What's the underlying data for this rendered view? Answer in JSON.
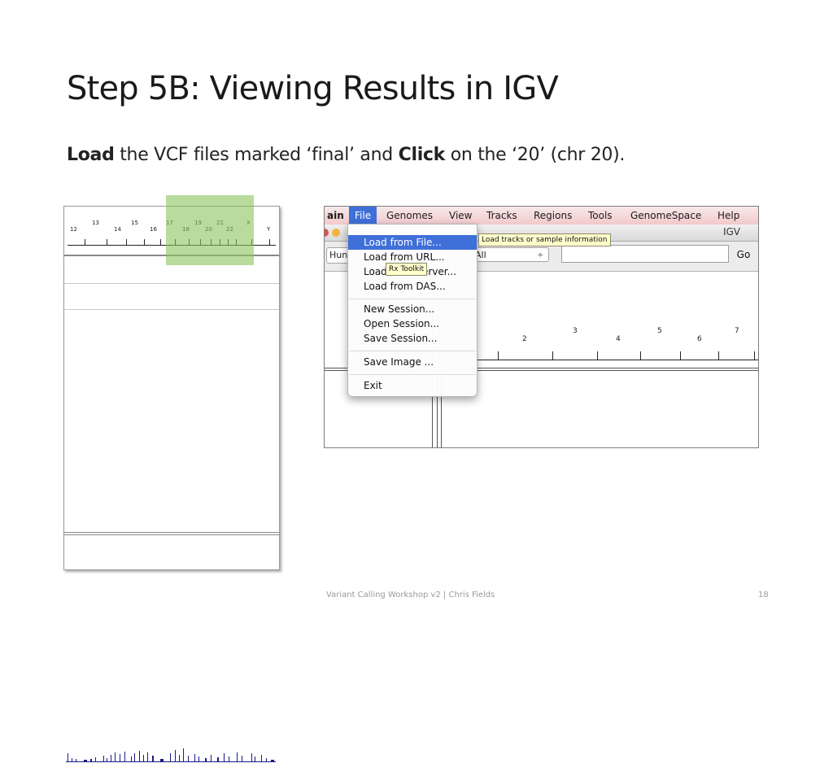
{
  "slide": {
    "title": "Step 5B: Viewing Results in IGV",
    "instruction": {
      "load_word": "Load",
      "part1": " the VCF files marked ‘final’ and ",
      "click_word": "Click",
      "part2": " on the ‘20’ (chr 20)."
    },
    "footer": "Variant Calling Workshop v2 | Chris Fields",
    "page_number": "18"
  },
  "left_panel": {
    "chromosome_labels_top": [
      "13",
      "15",
      "17",
      "19",
      "21",
      "X"
    ],
    "chromosome_labels_bottom": [
      "12",
      "14",
      "16",
      "18",
      "20",
      "22",
      "Y"
    ],
    "highlight_color": "#8bc35e",
    "coverage_color": "#1a1a8c"
  },
  "igv": {
    "menubar": {
      "items": [
        "ain",
        "File",
        "Genomes",
        "View",
        "Tracks",
        "Regions",
        "Tools",
        "GenomeSpace",
        "Help"
      ],
      "active": "File"
    },
    "window_title": "IGV",
    "genome_select": "Hun",
    "chr_select": "All",
    "chr_select_arrows": "÷",
    "locus_value": "",
    "go_label": "Go",
    "ruler_numbers": [
      "2",
      "3",
      "4",
      "5",
      "6",
      "7"
    ],
    "file_menu": {
      "items": [
        {
          "label": "Load from File...",
          "selected": true
        },
        {
          "label": "Load from URL...",
          "selected": false
        },
        {
          "label": "Load from Server...",
          "selected": false
        },
        {
          "label": "Load from DAS...",
          "selected": false
        },
        {
          "label": "New Session...",
          "selected": false
        },
        {
          "label": "Open Session...",
          "selected": false
        },
        {
          "label": "Save Session...",
          "selected": false
        },
        {
          "label": "Save Image ...",
          "selected": false
        },
        {
          "label": "Exit",
          "selected": false
        }
      ],
      "tooltip_load": "Load tracks or sample information",
      "tooltip_rx": "Rx Toolkit"
    }
  }
}
